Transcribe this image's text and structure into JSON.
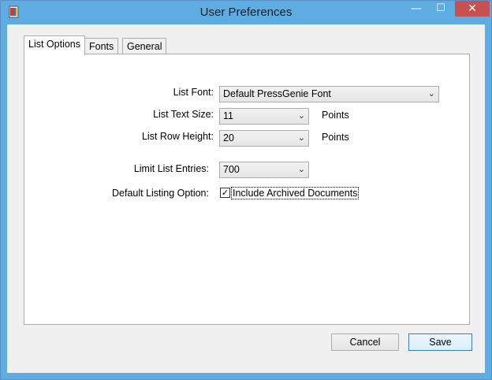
{
  "window": {
    "title": "User Preferences",
    "controls": {
      "minimize": "—",
      "maximize": "☐",
      "close": "✕"
    }
  },
  "tabs": [
    {
      "label": "List Options",
      "active": true
    },
    {
      "label": "Fonts",
      "active": false
    },
    {
      "label": "General",
      "active": false
    }
  ],
  "form": {
    "list_font": {
      "label": "List Font:",
      "value": "Default PressGenie Font"
    },
    "list_text_size": {
      "label": "List Text Size:",
      "value": "11",
      "unit": "Points"
    },
    "list_row_height": {
      "label": "List Row Height:",
      "value": "20",
      "unit": "Points"
    },
    "limit_list_entries": {
      "label": "Limit List Entries:",
      "value": "700"
    },
    "default_listing_option": {
      "label": "Default Listing Option:",
      "checkbox_label": "Include Archived Documents",
      "checked": true,
      "check_mark": "✓"
    }
  },
  "buttons": {
    "cancel": "Cancel",
    "save": "Save"
  },
  "icons": {
    "dropdown_arrow": "⌄"
  }
}
